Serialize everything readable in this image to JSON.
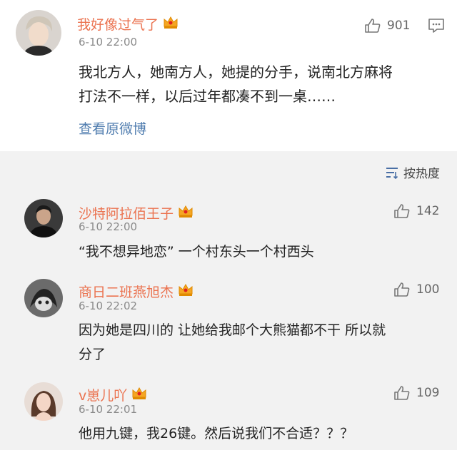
{
  "main_post": {
    "username": "我好像过气了",
    "time": "6-10 22:00",
    "likes": "901",
    "text_line1": "我北方人，她南方人，她提的分手，说南北方麻将",
    "text_line2": "打法不一样，以后过年都凑不到一桌……",
    "view_original": "查看原微博"
  },
  "sort": {
    "label": "按热度"
  },
  "comments": [
    {
      "username": "沙特阿拉佰王子",
      "time": "6-10 22:00",
      "likes": "142",
      "text_line1": "“我不想异地恋” 一个村东头一个村西头",
      "text_line2": ""
    },
    {
      "username": "商日二班燕旭杰",
      "time": "6-10 22:02",
      "likes": "100",
      "text_line1": "因为她是四川的 让她给我邮个大熊猫都不干 所以就",
      "text_line2": "分了"
    },
    {
      "username": "v崽儿吖",
      "time": "6-10 22:01",
      "likes": "109",
      "text_line1": "他用九键，我26键。然后说我们不合适？？？",
      "text_line2": ""
    }
  ],
  "colors": {
    "username": "#eb7350",
    "link": "#507daf",
    "crown": "#f5a623"
  },
  "icons": [
    "thumbs-up-icon",
    "comment-icon",
    "sort-icon",
    "crown-icon"
  ]
}
